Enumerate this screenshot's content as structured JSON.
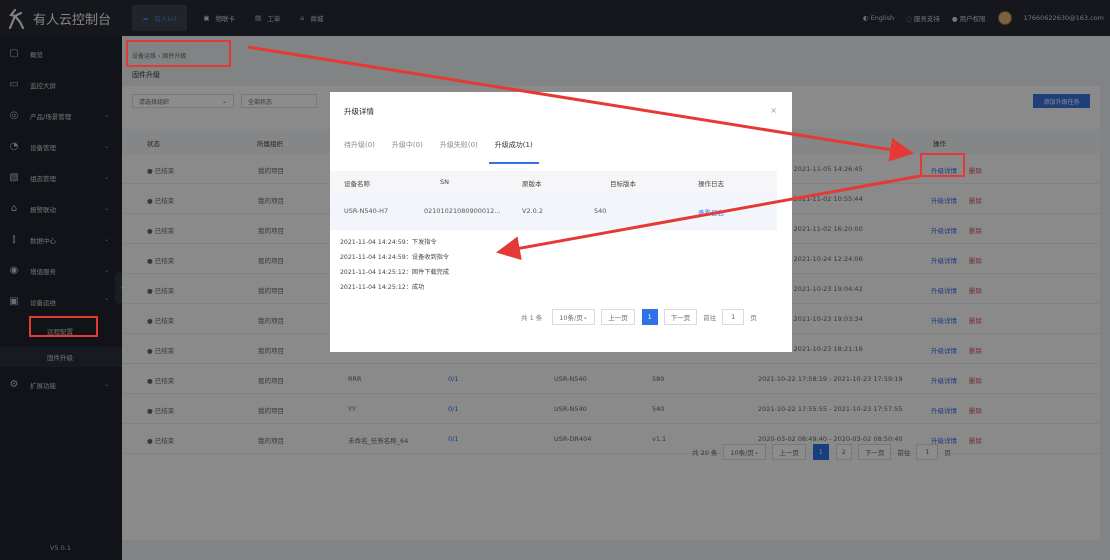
{
  "app": {
    "title": "有人云控制台"
  },
  "topnav": [
    {
      "label": "有人IoT"
    },
    {
      "label": "物联卡"
    },
    {
      "label": "工单"
    },
    {
      "label": "商城"
    }
  ],
  "topright": {
    "lang": "English",
    "support": "服务支持",
    "permission": "用户权限",
    "account": "17660622630@163.com"
  },
  "sidebar": [
    {
      "label": "概览",
      "icon": "dashboard-icon"
    },
    {
      "label": "监控大屏",
      "icon": "monitor-icon"
    },
    {
      "label": "产品/场景管理",
      "icon": "product-icon"
    },
    {
      "label": "设备管理",
      "icon": "device-icon"
    },
    {
      "label": "组态管理",
      "icon": "config-icon"
    },
    {
      "label": "报警联动",
      "icon": "alarm-icon"
    },
    {
      "label": "数据中心",
      "icon": "data-icon"
    },
    {
      "label": "增值服务",
      "icon": "service-icon"
    },
    {
      "label": "设备运维",
      "icon": "maintain-icon"
    }
  ],
  "sidebar_sub": [
    {
      "label": "远程配置"
    },
    {
      "label": "固件升级"
    }
  ],
  "sidebar_ext": {
    "label": "扩展功能"
  },
  "version": "V5.0.1",
  "breadcrumb": {
    "parent": "设备运维",
    "current": "固件升级"
  },
  "page_title": "固件升级",
  "filters": {
    "group": "请选择组织",
    "status": "全部状态"
  },
  "add_button": "添加升级任务",
  "table": {
    "headers": {
      "status": "状态",
      "org": "所属组织",
      "ops": "操作"
    },
    "rows": [
      {
        "status": "● 已结束",
        "org": "我的项目",
        "name": "",
        "progress": "",
        "product": "",
        "version": "",
        "time": "14:24:45 - 2021-11-05 14:26:45"
      },
      {
        "status": "● 已结束",
        "org": "我的项目",
        "name": "",
        "progress": "",
        "product": "",
        "version": "",
        "time": "18:01:44 - 2021-11-02 10:55:44"
      },
      {
        "status": "● 已结束",
        "org": "我的项目",
        "name": "",
        "progress": "",
        "product": "",
        "version": "",
        "time": "16:15:00 - 2021-11-02 16:20:00"
      },
      {
        "status": "● 已结束",
        "org": "我的项目",
        "name": "",
        "progress": "",
        "product": "",
        "version": "",
        "time": "12:23:06 - 2021-10-24 12:24:06"
      },
      {
        "status": "● 已结束",
        "org": "我的项目",
        "name": "",
        "progress": "",
        "product": "",
        "version": "",
        "time": "19:04:42 - 2021-10-23 19:04:42"
      },
      {
        "status": "● 已结束",
        "org": "我的项目",
        "name": "",
        "progress": "",
        "product": "",
        "version": "",
        "time": "19:03:34 - 2021-10-23 19:03:34"
      },
      {
        "status": "● 已结束",
        "org": "我的项目",
        "name": "",
        "progress": "",
        "product": "",
        "version": "",
        "time": "18:20:16 - 2021-10-23 18:21:16"
      },
      {
        "status": "● 已结束",
        "org": "我的项目",
        "name": "RRR",
        "progress": "0/1",
        "product": "USR-N540",
        "version": "580",
        "time": "2021-10-22 17:58:19 - 2021-10-23 17:59:19"
      },
      {
        "status": "● 已结束",
        "org": "我的项目",
        "name": "YY",
        "progress": "0/1",
        "product": "USR-N540",
        "version": "540",
        "time": "2021-10-22 17:55:55 - 2021-10-23 17:57:55"
      },
      {
        "status": "● 已结束",
        "org": "我的项目",
        "name": "未命名_任务名称_64",
        "progress": "0/1",
        "product": "USR-DR404",
        "version": "v1.1",
        "time": "2020-03-02 08:49:40 - 2020-03-02 08:50:40"
      }
    ],
    "row_actions": {
      "detail": "升级详情",
      "delete": "删除"
    }
  },
  "pager": {
    "total": "共 20 条",
    "size": "10条/页",
    "prev": "上一页",
    "pages": [
      "1",
      "2"
    ],
    "next": "下一页",
    "goto": "前往",
    "current": "1",
    "unit": "页"
  },
  "modal": {
    "title": "升级详情",
    "tabs": [
      "待升级(0)",
      "升级中(0)",
      "升级失败(0)",
      "升级成功(1)"
    ],
    "table": {
      "headers": [
        "设备名称",
        "SN",
        "原版本",
        "目标版本",
        "操作日志"
      ],
      "row": [
        "USR-N540-H7",
        "02101021080900012...",
        "V2.0.2",
        "540",
        "查看日志"
      ]
    },
    "log": [
      "2021-11-04 14:24:59：下发指令",
      "2021-11-04 14:24:59：设备收到指令",
      "2021-11-04 14:25:12：固件下载完成",
      "2021-11-04 14:25:12：成功"
    ],
    "pager": {
      "total": "共 1 条",
      "size": "10条/页",
      "prev": "上一页",
      "page": "1",
      "next": "下一页",
      "goto": "前往",
      "current": "1",
      "unit": "页"
    }
  }
}
